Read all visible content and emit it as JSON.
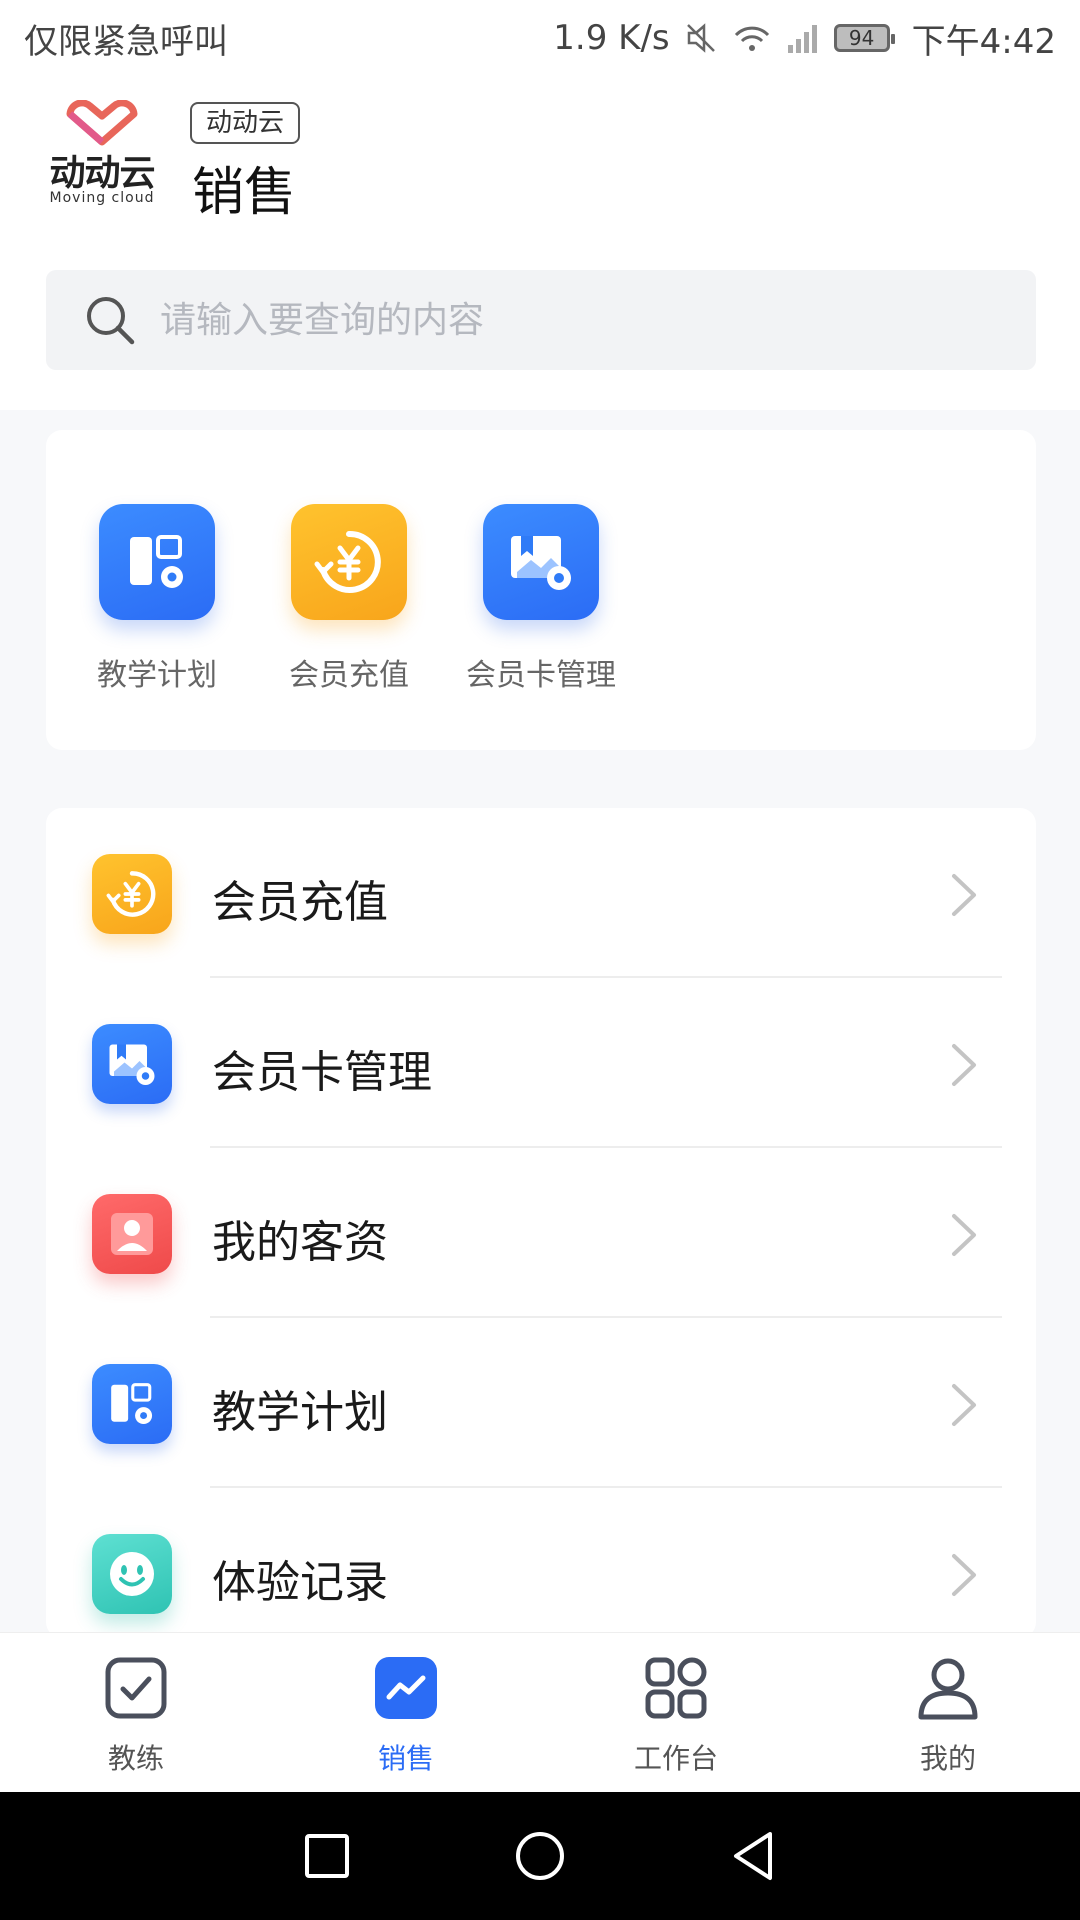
{
  "status_bar": {
    "carrier_text": "仅限紧急呼叫",
    "speed": "1.9 K/s",
    "battery": "94",
    "time": "下午4:42"
  },
  "header": {
    "logo_text": "动动云",
    "logo_subtext": "Moving cloud",
    "brand_tag": "动动云",
    "title": "销售"
  },
  "search": {
    "placeholder": "请输入要查询的内容"
  },
  "quick_entries": [
    {
      "label": "教学计划",
      "icon": "teaching-plan-icon",
      "color": "#2f7bf7"
    },
    {
      "label": "会员充值",
      "icon": "yuan-recharge-icon",
      "color": "#fbb127"
    },
    {
      "label": "会员卡管理",
      "icon": "member-card-icon",
      "color": "#2f7bf7"
    }
  ],
  "menu_items": [
    {
      "label": "会员充值",
      "icon": "yuan-recharge-icon",
      "color": "#fbb127"
    },
    {
      "label": "会员卡管理",
      "icon": "member-card-icon",
      "color": "#2f7bf7"
    },
    {
      "label": "我的客资",
      "icon": "customer-icon",
      "color": "#f25353"
    },
    {
      "label": "教学计划",
      "icon": "teaching-plan-icon",
      "color": "#2f7bf7"
    },
    {
      "label": "体验记录",
      "icon": "smile-icon",
      "color": "#3dcbbb"
    }
  ],
  "bottom_nav": [
    {
      "label": "教练",
      "icon": "checkbox-icon",
      "active": false
    },
    {
      "label": "销售",
      "icon": "trend-icon",
      "active": true
    },
    {
      "label": "工作台",
      "icon": "grid-icon",
      "active": false
    },
    {
      "label": "我的",
      "icon": "person-icon",
      "active": false
    }
  ],
  "colors": {
    "accent": "#2b6cf5",
    "background": "#f7f8fa"
  }
}
